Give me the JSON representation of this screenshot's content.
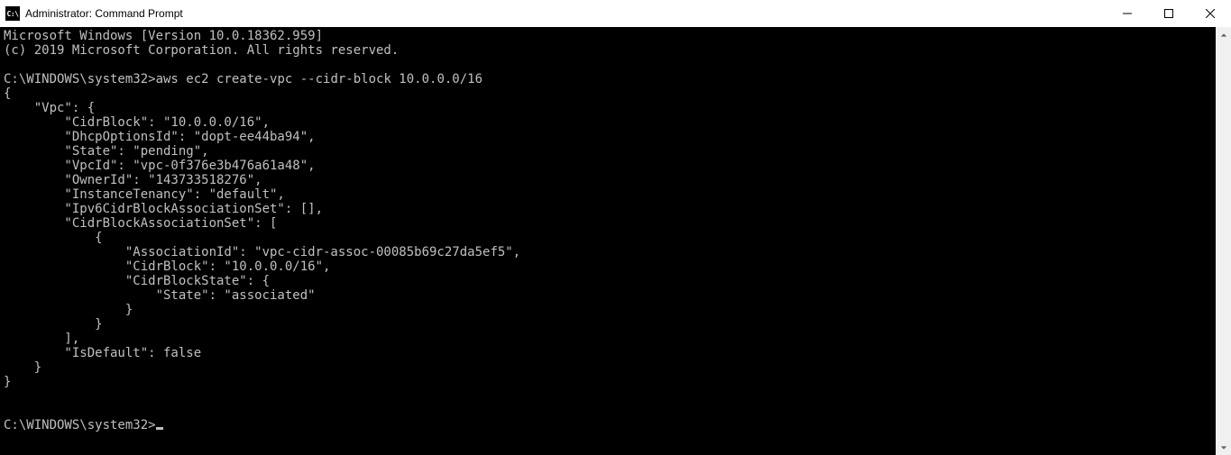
{
  "titlebar": {
    "title": "Administrator: Command Prompt",
    "icon_label": "C:\\"
  },
  "terminal": {
    "header_line1": "Microsoft Windows [Version 10.0.18362.959]",
    "header_line2": "(c) 2019 Microsoft Corporation. All rights reserved.",
    "prompt1_path": "C:\\WINDOWS\\system32>",
    "prompt1_cmd": "aws ec2 create-vpc --cidr-block 10.0.0.0/16",
    "output": {
      "l0": "{",
      "l1": "    \"Vpc\": {",
      "l2": "        \"CidrBlock\": \"10.0.0.0/16\",",
      "l3": "        \"DhcpOptionsId\": \"dopt-ee44ba94\",",
      "l4": "        \"State\": \"pending\",",
      "l5": "        \"VpcId\": \"vpc-0f376e3b476a61a48\",",
      "l6": "        \"OwnerId\": \"143733518276\",",
      "l7": "        \"InstanceTenancy\": \"default\",",
      "l8": "        \"Ipv6CidrBlockAssociationSet\": [],",
      "l9": "        \"CidrBlockAssociationSet\": [",
      "l10": "            {",
      "l11": "                \"AssociationId\": \"vpc-cidr-assoc-00085b69c27da5ef5\",",
      "l12": "                \"CidrBlock\": \"10.0.0.0/16\",",
      "l13": "                \"CidrBlockState\": {",
      "l14": "                    \"State\": \"associated\"",
      "l15": "                }",
      "l16": "            }",
      "l17": "        ],",
      "l18": "        \"IsDefault\": false",
      "l19": "    }",
      "l20": "}"
    },
    "prompt2_path": "C:\\WINDOWS\\system32>"
  }
}
